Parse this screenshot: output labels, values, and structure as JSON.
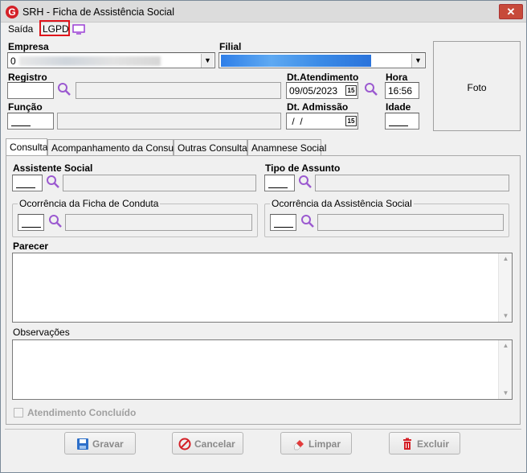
{
  "window": {
    "title": "SRH - Ficha de Assistência Social",
    "app_icon": "G",
    "close_glyph": "✕"
  },
  "menu": {
    "saida": "Saída",
    "lgpd": "LGPD",
    "monitor_icon": "monitor-icon"
  },
  "form": {
    "empresa_label": "Empresa",
    "empresa_value": "0",
    "filial_label": "Filial",
    "registro_label": "Registro",
    "dt_atendimento_label": "Dt.Atendimento",
    "dt_atendimento_value": "09/05/2023",
    "hora_label": "Hora",
    "hora_value": "16:56",
    "funcao_label": "Função",
    "dt_admissao_label": "Dt. Admissão",
    "dt_admissao_value": " /  /",
    "idade_label": "Idade",
    "foto_label": "Foto",
    "calendar_glyph": "15"
  },
  "tabs": [
    {
      "label": "Consulta",
      "active": true
    },
    {
      "label": "Acompanhamento da Consulta",
      "active": false
    },
    {
      "label": "Outras Consultas",
      "active": false
    },
    {
      "label": "Anamnese Social",
      "active": false
    }
  ],
  "consulta": {
    "assistente_social_label": "Assistente Social",
    "tipo_assunto_label": "Tipo de Assunto",
    "ocorrencia_ficha_label": "Ocorrência da Ficha de Conduta",
    "ocorrencia_assistencia_label": "Ocorrência da Assistência Social",
    "parecer_label": "Parecer",
    "observacoes_label": "Observações",
    "atendimento_concluido_label": "Atendimento Concluído",
    "atendimento_concluido_checked": false
  },
  "buttons": {
    "gravar": "Gravar",
    "cancelar": "Cancelar",
    "limpar": "Limpar",
    "excluir": "Excluir"
  },
  "colors": {
    "accent_red": "#e0141b",
    "search_icon": "#9b59d0",
    "selection_blue": "#2f7fe8"
  }
}
